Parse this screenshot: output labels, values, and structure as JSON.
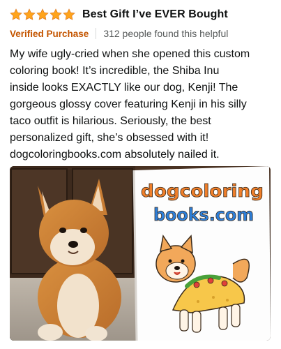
{
  "review": {
    "rating": 5,
    "max_rating": 5,
    "title": "Best Gift I’ve EVER Bought",
    "verified_label": "Verified Purchase",
    "helpful_text": "312 people found this helpful",
    "body_lines": [
      "My wife ugly-cried when she opened this custom",
      "coloring book! It’s incredible, the Shiba Inu",
      "inside looks EXACTLY like our dog, Kenji! The",
      "gorgeous glossy cover featuring Kenji in his silly",
      "taco outfit is hilarious. Seriously, the best",
      "personalized gift, she’s obsessed with it!",
      "dogcoloringbooks.com absolutely nailed it."
    ],
    "photo": {
      "logo_line1": "dogcoloring",
      "logo_line2": "books.com"
    }
  },
  "colors": {
    "star": "#ffa41c",
    "verified": "#c45500",
    "helpful": "#565959",
    "text": "#0f1111"
  },
  "icons": [
    "star-icon"
  ]
}
